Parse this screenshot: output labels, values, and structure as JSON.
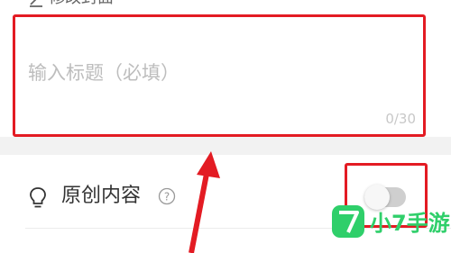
{
  "header": {
    "edit_cover_label": "修改封面",
    "edit_icon": "edit-icon"
  },
  "title_field": {
    "placeholder": "输入标题（必填）",
    "value": "",
    "char_count": "0/30"
  },
  "original_row": {
    "label": "原创内容",
    "icon": "lightbulb-icon",
    "help_icon": "help-icon",
    "toggle_on": false
  },
  "colors": {
    "highlight": "#e31b23",
    "watermark_green": "#2fcf6a"
  },
  "watermark": {
    "logo_text": "小7手游"
  }
}
